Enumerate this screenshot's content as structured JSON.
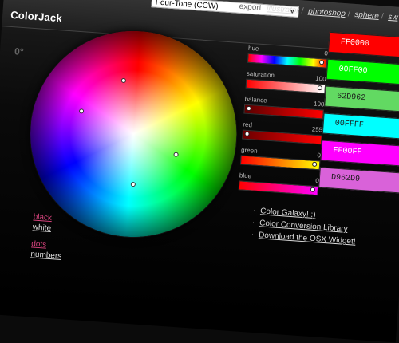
{
  "header": {
    "logo": "ColorJack",
    "scheme_select": {
      "value": "Four-Tone (CCW)"
    },
    "export_label": "export",
    "export_links": [
      "illustrator",
      "photoshop",
      "sphere",
      "sw"
    ]
  },
  "wheel": {
    "degree": "0°",
    "handles": [
      {
        "name": "handle-red"
      },
      {
        "name": "handle-magenta"
      },
      {
        "name": "handle-green"
      },
      {
        "name": "handle-cyan"
      }
    ]
  },
  "sliders": [
    {
      "label": "hue",
      "value": "0",
      "level": 0.98,
      "kind": "hue"
    },
    {
      "label": "saturation",
      "value": "100",
      "level": 0.98,
      "kind": "saturation"
    },
    {
      "label": "balance",
      "value": "100",
      "level": 0.03,
      "kind": "balance"
    },
    {
      "label": "red",
      "value": "255",
      "level": 0.03,
      "kind": "red"
    },
    {
      "label": "green",
      "value": "0",
      "level": 0.98,
      "kind": "green"
    },
    {
      "label": "blue",
      "value": "0",
      "level": 0.98,
      "kind": "blue"
    }
  ],
  "swatches": [
    {
      "hex": "FF0000",
      "color": "#ff0000",
      "text_color": "#ffffff"
    },
    {
      "hex": "00FF00",
      "color": "#00ff00",
      "text_color": "#ffffff"
    },
    {
      "hex": "62D962",
      "color": "#62d962",
      "text_color": "#1a1a1a"
    },
    {
      "hex": "00FFFF",
      "color": "#00ffff",
      "text_color": "#1a1a1a"
    },
    {
      "hex": "FF00FF",
      "color": "#ff00ff",
      "text_color": "#ffffff"
    },
    {
      "hex": "D962D9",
      "color": "#d962d9",
      "text_color": "#1a1a1a"
    }
  ],
  "links": [
    "Color Galaxy! :)",
    "Color Conversion Library",
    "Download the OSX Widget!"
  ],
  "toggles": {
    "black": "black",
    "white": "white",
    "dots": "dots",
    "numbers": "numbers"
  },
  "colors": {
    "accent_pink": "#d8447e",
    "background": "#0b0b0b"
  }
}
